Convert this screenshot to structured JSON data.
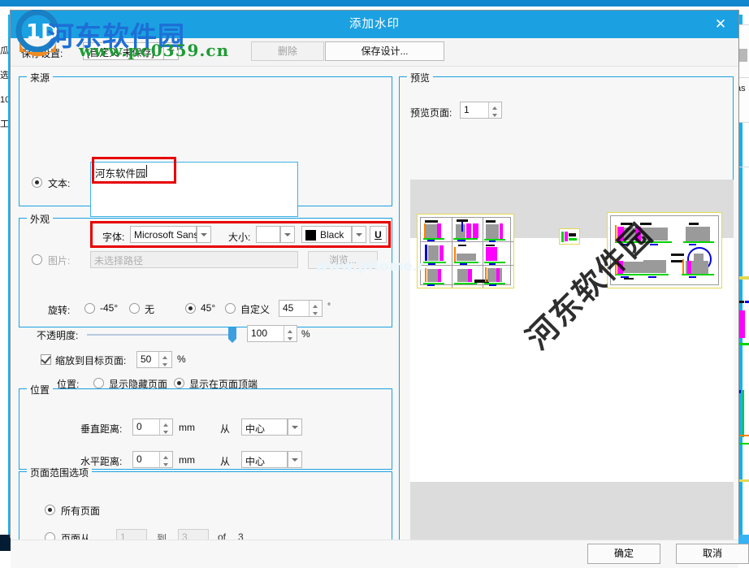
{
  "window": {
    "title": "添加水印",
    "close_label": "✕"
  },
  "toolbar": {
    "preset_label": "保存设置:",
    "preset_value": "[自定义-未保存]",
    "delete_label": "删除",
    "save_design_label": "保存设计..."
  },
  "source": {
    "group_title": "来源",
    "text_radio_label": "文本:",
    "text_value": "河东软件园",
    "font_label": "字体:",
    "font_value": "Microsoft Sans",
    "size_label": "大小:",
    "size_value": "",
    "color_label": "Black",
    "color_hex": "#000000",
    "underline_label": "U",
    "image_radio_label": "图片:",
    "image_path_placeholder": "未选择路径",
    "browse_label": "浏览..."
  },
  "appearance": {
    "group_title": "外观",
    "rotate_label": "旋转:",
    "rotate_options": [
      "-45°",
      "无",
      "45°",
      "自定义"
    ],
    "rotate_selected_index": 2,
    "rotate_custom_value": "45",
    "degree_symbol": "°",
    "opacity_label": "不透明度:",
    "opacity_value": "100",
    "opacity_unit": "%",
    "scale_label": "缩放到目标页面:",
    "scale_checked": true,
    "scale_value": "50",
    "scale_unit": "%",
    "position_label": "位置:",
    "position_options": [
      "显示隐藏页面",
      "显示在页面顶端"
    ],
    "position_selected_index": 1
  },
  "position": {
    "group_title": "位置",
    "vertical_label": "垂直距离:",
    "vertical_value": "0",
    "vertical_unit": "mm",
    "vertical_from_label": "从",
    "vertical_from_value": "中心",
    "horizontal_label": "水平距离:",
    "horizontal_value": "0",
    "horizontal_unit": "mm",
    "horizontal_from_label": "从",
    "horizontal_from_value": "中心"
  },
  "page_range": {
    "group_title": "页面范围选项",
    "all_pages_label": "所有页面",
    "range_label": "页面从",
    "from_value": "1",
    "to_label": "到",
    "to_value": "3",
    "of_label": "of",
    "total_pages": "3",
    "selected_index": 0
  },
  "preview": {
    "group_title": "预览",
    "page_label": "预览页面:",
    "page_value": "1",
    "watermark_text": "河东软件园"
  },
  "footer": {
    "ok_label": "确定",
    "cancel_label": "取消"
  },
  "site_watermark": {
    "name": "河东软件园",
    "url": "www.pc0359.cn",
    "faint": "www.pHome.c"
  },
  "background": {
    "left_chars": [
      "瓜",
      "选",
      "10",
      "工"
    ],
    "right_text": "as"
  }
}
